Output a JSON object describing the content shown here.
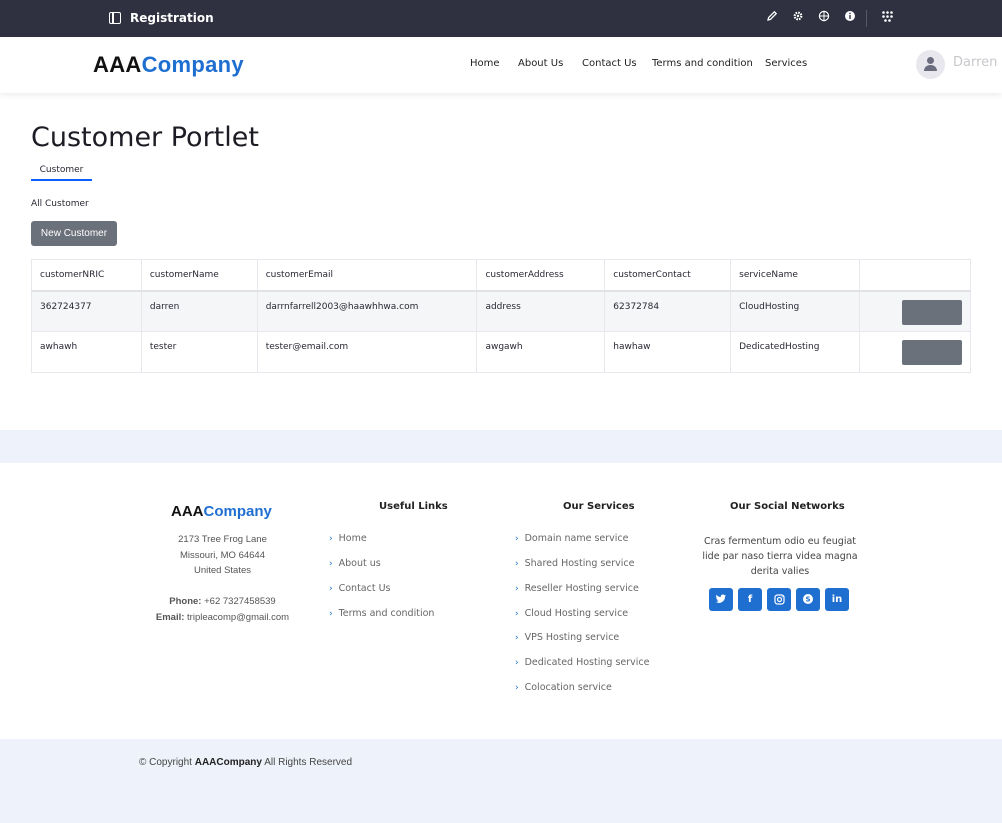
{
  "topbar": {
    "title": "Registration",
    "icons": [
      "pencil-icon",
      "gear-icon",
      "globe-icon",
      "info-icon",
      "apps-grid-icon"
    ]
  },
  "header": {
    "logo_part1": "AAA",
    "logo_part2": "Company",
    "nav": [
      "Home",
      "About Us",
      "Contact Us",
      "Terms and condition",
      "Services"
    ],
    "user_name": "Darren"
  },
  "main": {
    "title": "Customer Portlet",
    "tab": "Customer",
    "section_label": "All Customer",
    "new_button": "New Customer",
    "columns": [
      "customerNRIC",
      "customerName",
      "customerEmail",
      "customerAddress",
      "customerContact",
      "serviceName",
      ""
    ],
    "rows": [
      [
        "362724377",
        "darren",
        "darrnfarrell2003@haawhhwa.com",
        "address",
        "62372784",
        "CloudHosting"
      ],
      [
        "awhawh",
        "tester",
        "tester@email.com",
        "awgawh",
        "hawhaw",
        "DedicatedHosting"
      ]
    ]
  },
  "footer": {
    "logo_part1": "AAA",
    "logo_part2": "Company",
    "address_line1": "2173 Tree Frog Lane",
    "address_line2": "Missouri, MO 64644",
    "address_line3": "United States",
    "phone_label": "Phone:",
    "phone": "+62 7327458539",
    "email_label": "Email:",
    "email": "tripleacomp@gmail.com",
    "useful_links_title": "Useful Links",
    "useful_links": [
      "Home",
      "About us",
      "Contact Us",
      "Terms and condition"
    ],
    "services_title": "Our Services",
    "services": [
      "Domain name service",
      "Shared Hosting service",
      "Reseller Hosting service",
      "Cloud Hosting service",
      "VPS Hosting service",
      "Dedicated Hosting service",
      "Colocation service"
    ],
    "social_title": "Our Social Networks",
    "social_text": "Cras fermentum odio eu feugiat lide par naso tierra videa magna derita valies",
    "social_icons": [
      "twitter-icon",
      "facebook-icon",
      "instagram-icon",
      "skype-icon",
      "linkedin-icon"
    ],
    "copyright_prefix": "© Copyright",
    "copyright_brand": "AAACompany",
    "copyright_suffix": "All Rights Reserved"
  },
  "colors": {
    "accent": "#1f6fd1",
    "topbar": "#2f3140",
    "button": "#6b717a",
    "band": "#eef3fb"
  }
}
